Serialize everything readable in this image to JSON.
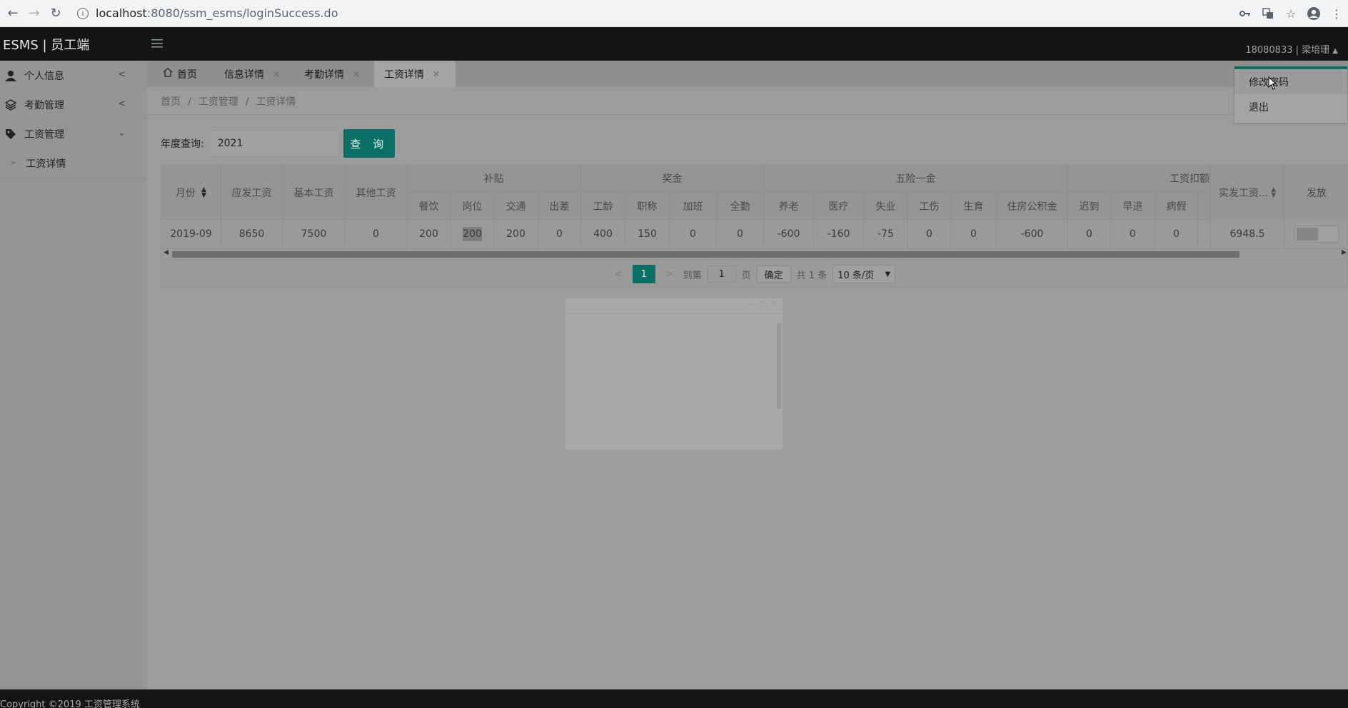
{
  "browser": {
    "url_host": "localhost",
    "url_path": ":8080/ssm_esms/loginSuccess.do"
  },
  "header": {
    "logo": "ESMS | 员工端",
    "user": "18080833 | 梁培珊"
  },
  "sidebar": {
    "items": [
      {
        "label": "个人信息",
        "icon": "user-icon"
      },
      {
        "label": "考勤管理",
        "icon": "layers-icon"
      },
      {
        "label": "工资管理",
        "icon": "tag-icon"
      }
    ],
    "sub_items": [
      {
        "label": "工资详情"
      }
    ]
  },
  "tabs": [
    {
      "label": "首页"
    },
    {
      "label": "信息详情"
    },
    {
      "label": "考勤详情"
    },
    {
      "label": "工资详情"
    }
  ],
  "breadcrumb": [
    "首页",
    "工资管理",
    "工资详情"
  ],
  "query": {
    "label": "年度查询:",
    "value": "2021",
    "button": "查 询"
  },
  "table": {
    "group_headers": {
      "subsidy": "补贴",
      "bonus": "奖金",
      "insurance": "五险一金",
      "deduction": "工资扣额"
    },
    "columns": {
      "month": "月份",
      "gross": "应发工资",
      "base": "基本工资",
      "other": "其他工资",
      "meal": "餐饮",
      "post": "岗位",
      "traffic": "交通",
      "trip": "出差",
      "seniority": "工龄",
      "title": "职称",
      "overtime": "加班",
      "fullatt": "全勤",
      "pension": "养老",
      "medical": "医疗",
      "unemploy": "失业",
      "injury": "工伤",
      "birth": "生育",
      "fund": "住房公积金",
      "late": "迟到",
      "early": "早退",
      "sick": "病假",
      "net": "实发工资...",
      "issued": "发放"
    },
    "row": {
      "month": "2019-09",
      "gross": "8650",
      "base": "7500",
      "other": "0",
      "meal": "200",
      "post": "200",
      "traffic": "200",
      "trip": "0",
      "seniority": "400",
      "title": "150",
      "overtime": "0",
      "fullatt": "0",
      "pension": "-600",
      "medical": "-160",
      "unemploy": "-75",
      "injury": "0",
      "birth": "0",
      "fund": "-600",
      "late": "0",
      "early": "0",
      "sick": "0",
      "net": "6948.5"
    }
  },
  "pager": {
    "current": "1",
    "goto_label": "到第",
    "goto_value": "1",
    "page_unit": "页",
    "confirm": "确定",
    "total": "共 1 条",
    "per_page": "10 条/页"
  },
  "dropdown": {
    "items": [
      "修改密码",
      "退出"
    ]
  },
  "footer": {
    "text": "Copyright ©2019 工资管理系统"
  }
}
